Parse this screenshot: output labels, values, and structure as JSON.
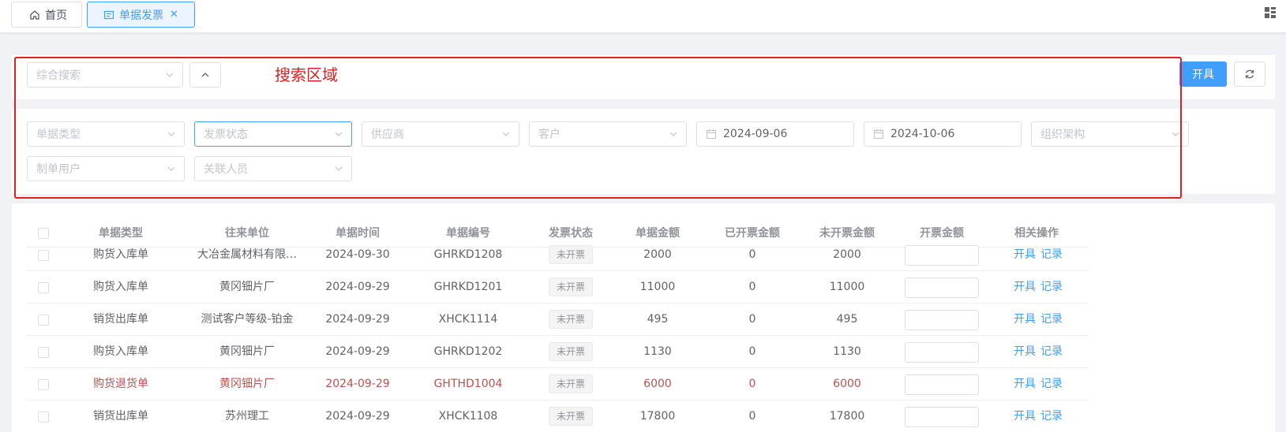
{
  "tabs": [
    {
      "label": "首页",
      "icon": "home-icon"
    },
    {
      "label": "单据发票",
      "icon": "invoice-icon",
      "closable": true
    }
  ],
  "search": {
    "general_placeholder": "综合搜索",
    "annotation_label": "搜索区域",
    "issue_button": "开具",
    "filters": {
      "doc_type": "单据类型",
      "invoice_status": "发票状态",
      "supplier": "供应商",
      "customer": "客户",
      "start_date": "2024-09-06",
      "end_date": "2024-10-06",
      "org": "组织架构",
      "creator": "制单用户",
      "related_person": "关联人员"
    }
  },
  "table": {
    "columns": [
      "单据类型",
      "往来单位",
      "单据时间",
      "单据编号",
      "发票状态",
      "单据金额",
      "已开票金额",
      "未开票金额",
      "开票金额",
      "相关操作"
    ],
    "actions": {
      "issue": "开具",
      "record": "记录"
    },
    "rows": [
      {
        "type": "购货入库单",
        "party": "大冶金属材料有限…",
        "date": "2024-09-30",
        "no": "GHRKD1208",
        "status": "未开票",
        "amount": "2000",
        "invoiced": "0",
        "uninvoiced": "2000",
        "highlight": false
      },
      {
        "type": "购货入库单",
        "party": "黄冈钿片厂",
        "date": "2024-09-29",
        "no": "GHRKD1201",
        "status": "未开票",
        "amount": "11000",
        "invoiced": "0",
        "uninvoiced": "11000",
        "highlight": false
      },
      {
        "type": "销货出库单",
        "party": "测试客户等级-铂金",
        "date": "2024-09-29",
        "no": "XHCK1114",
        "status": "未开票",
        "amount": "495",
        "invoiced": "0",
        "uninvoiced": "495",
        "highlight": false
      },
      {
        "type": "购货入库单",
        "party": "黄冈钿片厂",
        "date": "2024-09-29",
        "no": "GHRKD1202",
        "status": "未开票",
        "amount": "1130",
        "invoiced": "0",
        "uninvoiced": "1130",
        "highlight": false
      },
      {
        "type": "购货退货单",
        "party": "黄冈钿片厂",
        "date": "2024-09-29",
        "no": "GHTHD1004",
        "status": "未开票",
        "amount": "6000",
        "invoiced": "0",
        "uninvoiced": "6000",
        "highlight": true
      },
      {
        "type": "销货出库单",
        "party": "苏州理工",
        "date": "2024-09-29",
        "no": "XHCK1108",
        "status": "未开票",
        "amount": "17800",
        "invoiced": "0",
        "uninvoiced": "17800",
        "highlight": false
      }
    ]
  },
  "colors": {
    "primary": "#409eff",
    "annotation": "#e02020",
    "return_row": "#c0504d"
  }
}
